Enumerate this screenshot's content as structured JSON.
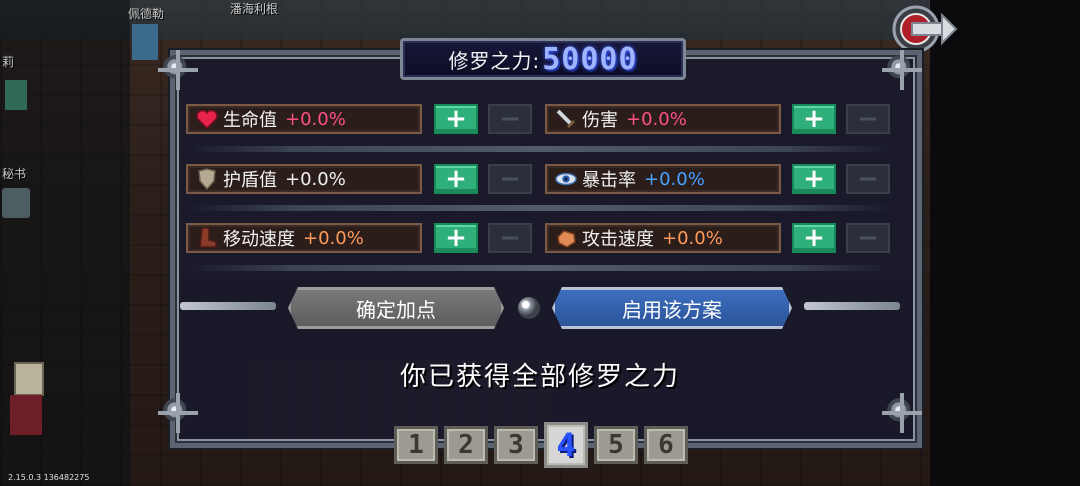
{
  "npc_labels": [
    "佩德勒",
    "潘海利根",
    "莉",
    "秘书"
  ],
  "version": "2.15.0.3 136482275",
  "header": {
    "title": "修罗之力:",
    "value": "50000"
  },
  "stats": [
    {
      "id": "hp",
      "name": "生命值",
      "value": "+0.0%",
      "icon": "heart-icon",
      "value_color": "#ff4f86"
    },
    {
      "id": "damage",
      "name": "伤害",
      "value": "+0.0%",
      "icon": "sword-icon",
      "value_color": "#ff4f86"
    },
    {
      "id": "shield",
      "name": "护盾值",
      "value": "+0.0%",
      "icon": "shield-icon",
      "value_color": "#f1f1f1"
    },
    {
      "id": "crit",
      "name": "暴击率",
      "value": "+0.0%",
      "icon": "eye-icon",
      "value_color": "#48a0ff"
    },
    {
      "id": "move_speed",
      "name": "移动速度",
      "value": "+0.0%",
      "icon": "boot-icon",
      "value_color": "#ff9a5a"
    },
    {
      "id": "attack_speed",
      "name": "攻击速度",
      "value": "+0.0%",
      "icon": "fist-icon",
      "value_color": "#ff9a5a"
    }
  ],
  "buttons": {
    "plus": "+",
    "minus": "−",
    "confirm": "确定加点",
    "apply": "启用该方案"
  },
  "message": "你已获得全部修罗之力",
  "tabs": [
    "1",
    "2",
    "3",
    "4",
    "5",
    "6"
  ],
  "active_tab": "4"
}
